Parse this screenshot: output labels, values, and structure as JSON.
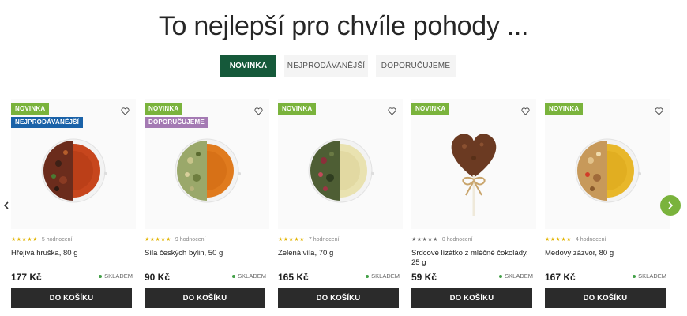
{
  "heading": "To nejlepší pro chvíle pohody ...",
  "tabs": [
    {
      "label": "NOVINKA",
      "active": true
    },
    {
      "label": "NEJPRODÁVANĚJŠÍ",
      "active": false
    },
    {
      "label": "DOPORUČUJEME",
      "active": false
    }
  ],
  "products": [
    {
      "badges": [
        "NOVINKA",
        "NEJPRODÁVANĚJŠÍ"
      ],
      "stars": "★★★★★",
      "reviews": "5 hodnocení",
      "name": "Hřejivá hruška, 80 g",
      "price": "177 Kč",
      "stock": "SKLADEM",
      "cart": "DO KOŠÍKU",
      "tea_color": "#c7461d"
    },
    {
      "badges": [
        "NOVINKA",
        "DOPORUČUJEME"
      ],
      "stars": "★★★★★",
      "reviews": "9 hodnocení",
      "name": "Síla českých bylin, 50 g",
      "price": "90 Kč",
      "stock": "SKLADEM",
      "cart": "DO KOŠÍKU",
      "tea_color": "#e07b1e"
    },
    {
      "badges": [
        "NOVINKA"
      ],
      "stars": "★★★★★",
      "reviews": "7 hodnocení",
      "name": "Zelená víla, 70 g",
      "price": "165 Kč",
      "stock": "SKLADEM",
      "cart": "DO KOŠÍKU",
      "tea_color": "#e9e2b0"
    },
    {
      "badges": [
        "NOVINKA"
      ],
      "stars": "★★★★★",
      "reviews": "0 hodnocení",
      "name": "Srdcové lízátko z mléčné čokolády, 25 g",
      "price": "59 Kč",
      "stock": "SKLADEM",
      "cart": "DO KOŠÍKU",
      "tea_color": "#6b3a22"
    },
    {
      "badges": [
        "NOVINKA"
      ],
      "stars": "★★★★★",
      "reviews": "4 hodnocení",
      "name": "Medový zázvor, 80 g",
      "price": "167 Kč",
      "stock": "SKLADEM",
      "cart": "DO KOŠÍKU",
      "tea_color": "#e8b72a"
    }
  ],
  "colors": {
    "brand_green": "#15593a",
    "accent_green": "#7ab33c",
    "badge_blue": "#1a62a8",
    "badge_purple": "#a47ab3",
    "button_dark": "#2b2b2b"
  },
  "icons": {
    "wishlist": "heart-icon",
    "prev": "chevron-left-icon",
    "next": "chevron-right-icon"
  }
}
